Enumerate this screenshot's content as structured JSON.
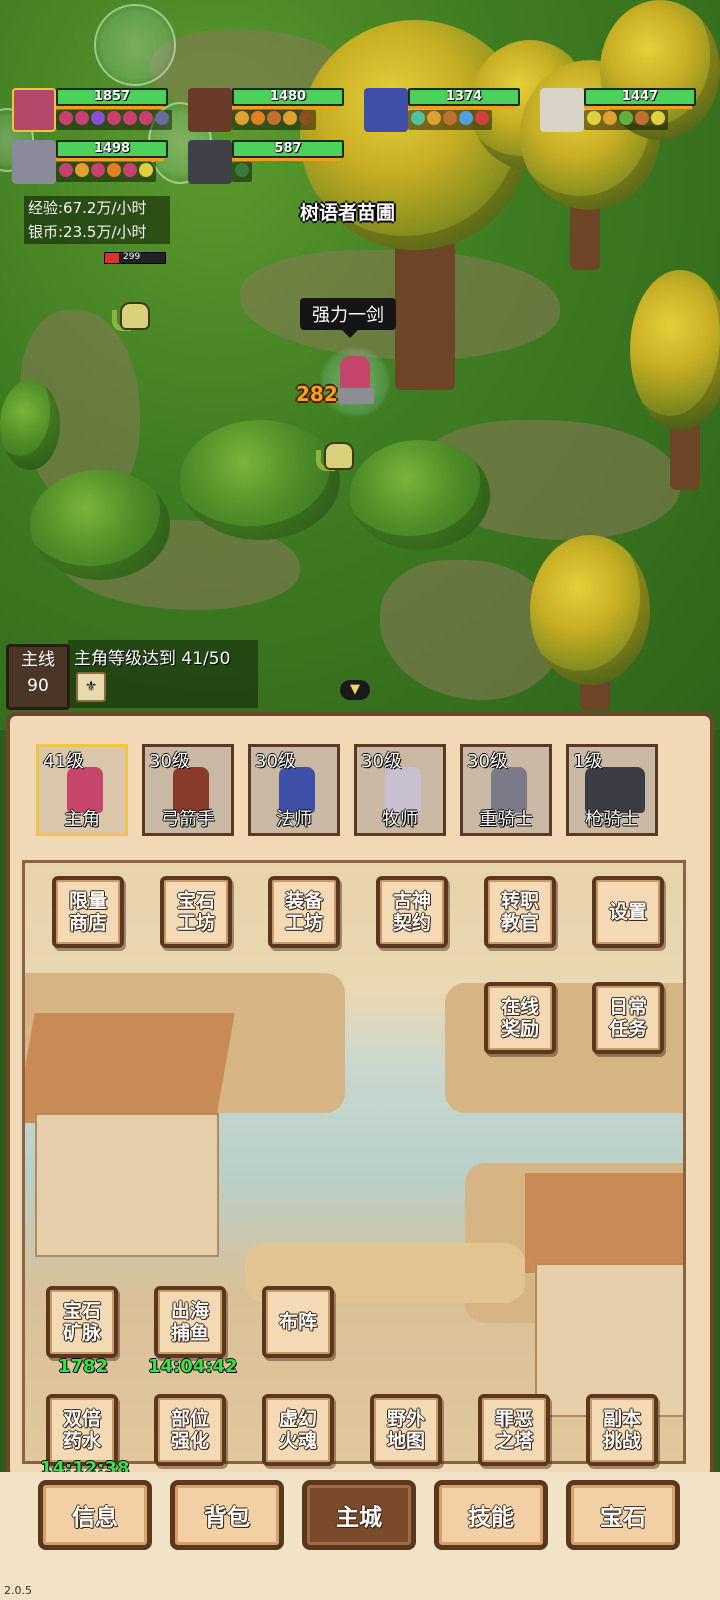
{
  "party": [
    {
      "hp": "1857"
    },
    {
      "hp": "1480"
    },
    {
      "hp": "1374"
    },
    {
      "hp": "1447"
    },
    {
      "hp": "1498"
    },
    {
      "hp": "587"
    }
  ],
  "stats": {
    "exp": "经验:67.2万/小时",
    "silver": "银币:23.5万/小时",
    "mini_hp": "299"
  },
  "area_name": "树语者苗圃",
  "skill_bubble": "强力一剑",
  "damage_number": "282",
  "main_quest": {
    "label": "主线",
    "number": "90",
    "text": "主角等级达到 41/50"
  },
  "roster": [
    {
      "level": "41级",
      "name": "主角"
    },
    {
      "level": "30级",
      "name": "弓箭手"
    },
    {
      "level": "30级",
      "name": "法师"
    },
    {
      "level": "30级",
      "name": "牧师"
    },
    {
      "level": "30级",
      "name": "重骑士"
    },
    {
      "level": "1级",
      "name": "枪骑士"
    }
  ],
  "menu": {
    "limited_shop": "限量\n商店",
    "gem_workshop": "宝石\n工坊",
    "equip_workshop": "装备\n工坊",
    "ancient_pact": "古神\n契约",
    "job_change": "转职\n教官",
    "settings": "设置",
    "online_reward": "在线\n奖励",
    "daily_tasks": "日常\n任务",
    "gem_mine": "宝石\n矿脉",
    "gem_mine_value": "1782",
    "fishing": "出海\n捕鱼",
    "fishing_timer": "14:04:42",
    "formation": "布阵",
    "double_potion": "双倍\n药水",
    "double_potion_timer": "14:12:38",
    "part_enhance": "部位\n强化",
    "phantom_soul": "虚幻\n火魂",
    "field_map": "野外\n地图",
    "sin_tower": "罪恶\n之塔",
    "dungeon": "副本\n挑战"
  },
  "nav": {
    "info": "信息",
    "bag": "背包",
    "main_city": "主城",
    "skills": "技能",
    "gems": "宝石"
  },
  "version": "2.0.5",
  "colors": {
    "hp_green": "#4bd25a",
    "timer_green": "#3ce04a",
    "frame_brown": "#5a3820",
    "damage_orange": "#f3a31e"
  }
}
